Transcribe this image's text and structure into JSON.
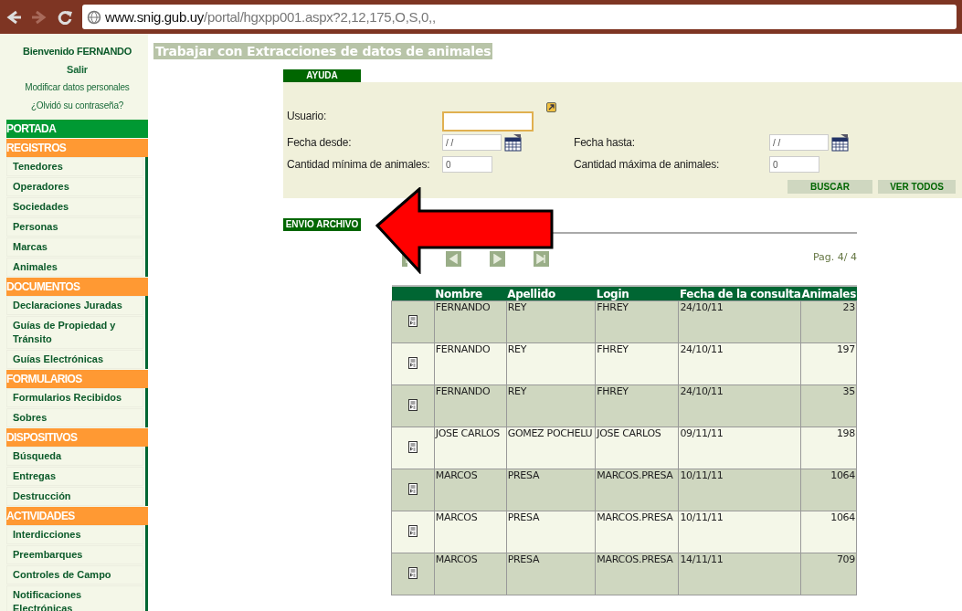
{
  "browser": {
    "url_host": "www.snig.gub.uy",
    "url_path": "/portal/hgxpp001.aspx?2,12,175,O,S,0,,"
  },
  "sidebar": {
    "welcome": "Bienvenido FERNANDO",
    "links": [
      "Salir",
      "Modificar datos personales",
      "¿Olvidó su contraseña?"
    ],
    "sections": [
      {
        "title": "PORTADA",
        "kind": "home"
      },
      {
        "title": "REGISTROS",
        "kind": "group",
        "items": [
          "Tenedores",
          "Operadores",
          "Sociedades",
          "Personas",
          "Marcas",
          "Animales"
        ]
      },
      {
        "title": "DOCUMENTOS",
        "kind": "group",
        "items": [
          "Declaraciones Juradas",
          "Guías de Propiedad y Tránsito",
          "Guías Electrónicas"
        ]
      },
      {
        "title": "FORMULARIOS",
        "kind": "group",
        "items": [
          "Formularios Recibidos",
          "Sobres"
        ]
      },
      {
        "title": "DISPOSITIVOS",
        "kind": "group",
        "items": [
          "Búsqueda",
          "Entregas",
          "Destrucción"
        ]
      },
      {
        "title": "ACTIVIDADES",
        "kind": "group",
        "items": [
          "Interdicciones",
          "Preembarques",
          "Controles de Campo",
          "Notificaciones Electrónicas"
        ]
      }
    ]
  },
  "page_title": "Trabajar con Extracciones de datos de animales",
  "help_tab": "AYUDA",
  "filters": [
    {
      "label": "Usuario:",
      "kind": "lookup",
      "focused": true
    },
    {
      "label": "Fecha desde:",
      "kind": "date",
      "value": "/ /",
      "focused": false
    },
    {
      "label": "Fecha hasta:",
      "kind": "date",
      "value": "/ /",
      "focused": false
    },
    {
      "label": "Cantidad mínima de animales:",
      "kind": "number",
      "value": "0",
      "focused": false
    },
    {
      "label": "Cantidad máxima de animales:",
      "kind": "number",
      "value": "0",
      "focused": false
    }
  ],
  "buttons": [
    "BUSCAR",
    "VER TODOS"
  ],
  "upload_tab": "ENVIO ARCHIVO",
  "pager": {
    "label": "Pag. 4/ 4"
  },
  "table": {
    "columns": [
      "Nombre",
      "Apellido",
      "Login",
      "Fecha de la consulta",
      "Animales"
    ],
    "rows": [
      [
        "FERNANDO",
        "REY",
        "FHREY",
        "24/10/11",
        "23"
      ],
      [
        "FERNANDO",
        "REY",
        "FHREY",
        "24/10/11",
        "197"
      ],
      [
        "FERNANDO",
        "REY",
        "FHREY",
        "24/10/11",
        "35"
      ],
      [
        "JOSE CARLOS",
        "GOMEZ POCHELU",
        "JOSE CARLOS",
        "09/11/11",
        "198"
      ],
      [
        "MARCOS",
        "PRESA",
        "MARCOS.PRESA",
        "10/11/11",
        "1064"
      ],
      [
        "MARCOS",
        "PRESA",
        "MARCOS.PRESA",
        "10/11/11",
        "1064"
      ],
      [
        "MARCOS",
        "PRESA",
        "MARCOS.PRESA",
        "14/11/11",
        "709"
      ]
    ]
  }
}
